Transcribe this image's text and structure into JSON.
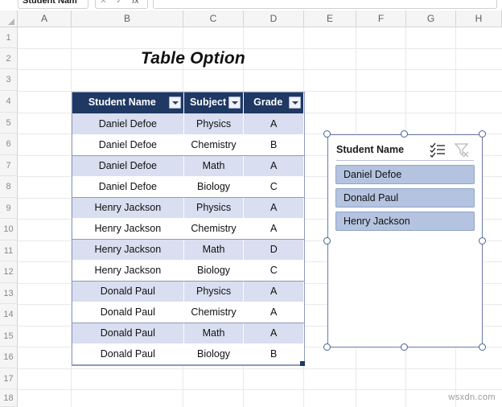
{
  "formula_bar": {
    "name_box_value": "Student Nam",
    "cancel_label": "✕",
    "enter_label": "✓",
    "fx_label": "fx",
    "formula_value": ""
  },
  "grid": {
    "column_headers": [
      "A",
      "B",
      "C",
      "D",
      "E",
      "F",
      "G",
      "H"
    ],
    "row_headers": [
      "1",
      "2",
      "3",
      "4",
      "5",
      "6",
      "7",
      "8",
      "9",
      "10",
      "11",
      "12",
      "13",
      "14",
      "15",
      "16",
      "17",
      "18"
    ]
  },
  "sheet": {
    "title": "Table Option"
  },
  "table": {
    "headers": [
      "Student Name",
      "Subject",
      "Grade"
    ],
    "rows": [
      [
        "Daniel Defoe",
        "Physics",
        "A"
      ],
      [
        "Daniel Defoe",
        "Chemistry",
        "B"
      ],
      [
        "Daniel Defoe",
        "Math",
        "A"
      ],
      [
        "Daniel Defoe",
        "Biology",
        "C"
      ],
      [
        "Henry Jackson",
        "Physics",
        "A"
      ],
      [
        "Henry Jackson",
        "Chemistry",
        "A"
      ],
      [
        "Henry Jackson",
        "Math",
        "D"
      ],
      [
        "Henry Jackson",
        "Biology",
        "C"
      ],
      [
        "Donald Paul",
        "Physics",
        "A"
      ],
      [
        "Donald Paul",
        "Chemistry",
        "A"
      ],
      [
        "Donald Paul",
        "Math",
        "A"
      ],
      [
        "Donald Paul",
        "Biology",
        "B"
      ]
    ],
    "header_fill": "#1f3864",
    "band_fill": "#d9def0"
  },
  "slicer": {
    "title": "Student Name",
    "multi_select_icon": "multi-select-icon",
    "clear_filter_icon": "clear-filter-icon",
    "items": [
      "Daniel Defoe",
      "Donald Paul",
      "Henry Jackson"
    ],
    "item_fill": "#b4c4e0",
    "border_color": "#6b7ba5"
  },
  "watermark": {
    "text": "wsxdn.com"
  }
}
